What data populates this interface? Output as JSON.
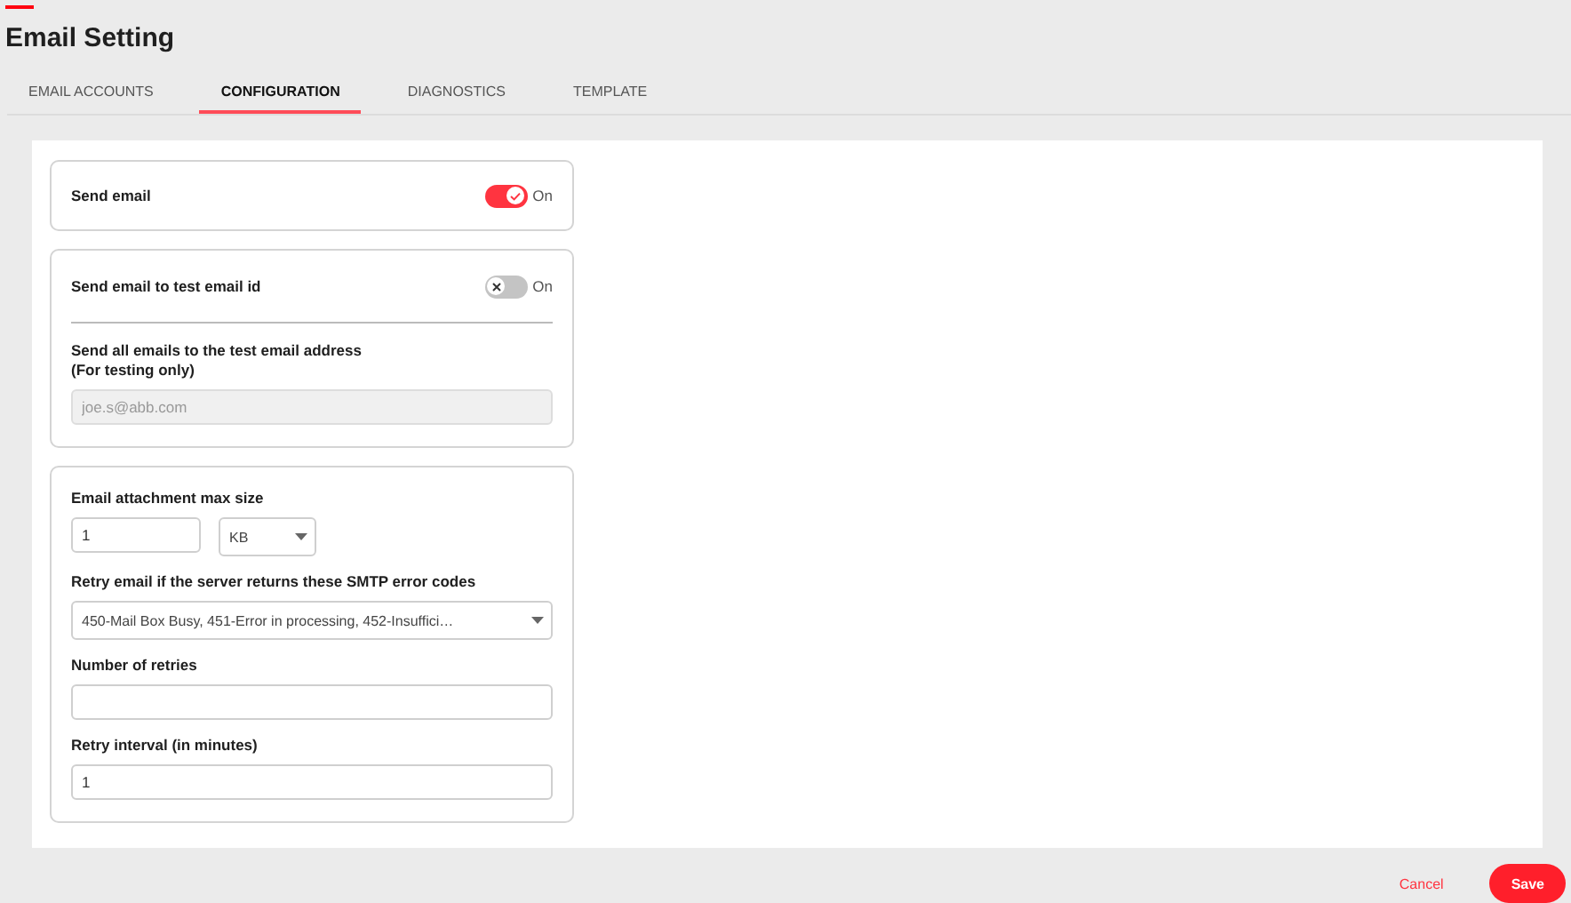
{
  "header": {
    "title": "Email Setting"
  },
  "tabs": [
    {
      "label": "EMAIL ACCOUNTS",
      "selected": false
    },
    {
      "label": "CONFIGURATION",
      "selected": true
    },
    {
      "label": "DIAGNOSTICS",
      "selected": false
    },
    {
      "label": "TEMPLATE",
      "selected": false
    }
  ],
  "send_email": {
    "label": "Send email",
    "on": true,
    "state_label": "On"
  },
  "test_email": {
    "label": "Send email to test email id",
    "on": false,
    "state_label": "On",
    "field_label": "Send all emails to the test email address\n(For testing only)",
    "placeholder": "joe.s@abb.com",
    "disabled": true
  },
  "limits": {
    "attachment": {
      "label": "Email attachment max size",
      "value": "1",
      "unit": "KB"
    },
    "smtp": {
      "label": "Retry email if the server returns these SMTP error codes",
      "value": "450-Mail Box Busy, 451-Error in processing, 452-Insuffici…"
    },
    "retries": {
      "label": "Number of retries"
    },
    "interval": {
      "label": "Retry interval (in minutes)",
      "value": "1"
    }
  },
  "footer": {
    "cancel": "Cancel",
    "save": "Save"
  }
}
